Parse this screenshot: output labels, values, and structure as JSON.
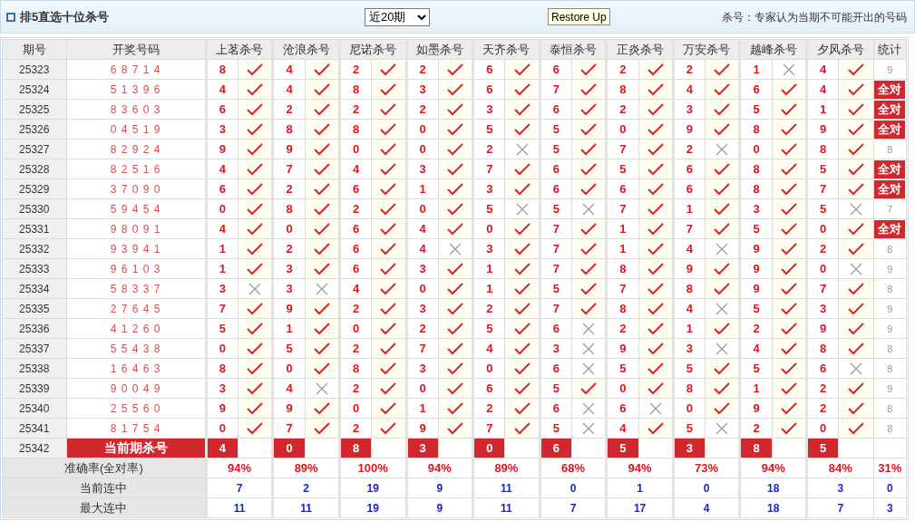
{
  "header": {
    "title": "排5直选十位杀号",
    "period_select": "近20期",
    "restore_button": "Restore Up",
    "note": "杀号：专家认为当期不可能开出的号码"
  },
  "table": {
    "columns": [
      "期号",
      "开奖号码",
      "上茗杀号",
      "沧浪杀号",
      "尼诺杀号",
      "如墨杀号",
      "天齐杀号",
      "泰恒杀号",
      "正炎杀号",
      "万安杀号",
      "越峰杀号",
      "夕风杀号",
      "统计"
    ],
    "rows": [
      {
        "period": "25323",
        "draw": "6 8 7 1 4",
        "picks": [
          "8",
          "4",
          "2",
          "2",
          "6",
          "6",
          "2",
          "2",
          "1",
          "4"
        ],
        "hits": [
          true,
          true,
          true,
          true,
          true,
          true,
          true,
          true,
          false,
          true
        ],
        "stat": {
          "kind": "count",
          "text": "9"
        }
      },
      {
        "period": "25324",
        "draw": "5 1 3 9 6",
        "picks": [
          "4",
          "4",
          "8",
          "3",
          "6",
          "7",
          "8",
          "4",
          "6",
          "4"
        ],
        "hits": [
          true,
          true,
          true,
          true,
          true,
          true,
          true,
          true,
          true,
          true
        ],
        "stat": {
          "kind": "all_correct",
          "text": "全对"
        }
      },
      {
        "period": "25325",
        "draw": "8 3 6 0 3",
        "picks": [
          "6",
          "2",
          "2",
          "2",
          "3",
          "6",
          "2",
          "3",
          "5",
          "1"
        ],
        "hits": [
          true,
          true,
          true,
          true,
          true,
          true,
          true,
          true,
          true,
          true
        ],
        "stat": {
          "kind": "all_correct",
          "text": "全对"
        }
      },
      {
        "period": "25326",
        "draw": "0 4 5 1 9",
        "picks": [
          "3",
          "8",
          "8",
          "0",
          "5",
          "5",
          "0",
          "9",
          "8",
          "9"
        ],
        "hits": [
          true,
          true,
          true,
          true,
          true,
          true,
          true,
          true,
          true,
          true
        ],
        "stat": {
          "kind": "all_correct",
          "text": "全对"
        }
      },
      {
        "period": "25327",
        "draw": "8 2 9 2 4",
        "picks": [
          "9",
          "9",
          "0",
          "0",
          "2",
          "5",
          "7",
          "2",
          "0",
          "8"
        ],
        "hits": [
          true,
          true,
          true,
          true,
          false,
          true,
          true,
          false,
          true,
          true
        ],
        "stat": {
          "kind": "count",
          "text": "8"
        }
      },
      {
        "period": "25328",
        "draw": "8 2 5 1 6",
        "picks": [
          "4",
          "7",
          "4",
          "3",
          "7",
          "6",
          "5",
          "6",
          "8",
          "5"
        ],
        "hits": [
          true,
          true,
          true,
          true,
          true,
          true,
          true,
          true,
          true,
          true
        ],
        "stat": {
          "kind": "all_correct",
          "text": "全对"
        }
      },
      {
        "period": "25329",
        "draw": "3 7 0 9 0",
        "picks": [
          "6",
          "2",
          "6",
          "1",
          "3",
          "6",
          "6",
          "6",
          "8",
          "7"
        ],
        "hits": [
          true,
          true,
          true,
          true,
          true,
          true,
          true,
          true,
          true,
          true
        ],
        "stat": {
          "kind": "all_correct",
          "text": "全对"
        }
      },
      {
        "period": "25330",
        "draw": "5 9 4 5 4",
        "picks": [
          "0",
          "8",
          "2",
          "0",
          "5",
          "5",
          "7",
          "1",
          "3",
          "5"
        ],
        "hits": [
          true,
          true,
          true,
          true,
          false,
          false,
          true,
          true,
          true,
          false
        ],
        "stat": {
          "kind": "count",
          "text": "7"
        }
      },
      {
        "period": "25331",
        "draw": "9 8 0 9 1",
        "picks": [
          "4",
          "0",
          "6",
          "4",
          "0",
          "7",
          "1",
          "7",
          "5",
          "0"
        ],
        "hits": [
          true,
          true,
          true,
          true,
          true,
          true,
          true,
          true,
          true,
          true
        ],
        "stat": {
          "kind": "all_correct",
          "text": "全对"
        }
      },
      {
        "period": "25332",
        "draw": "9 3 9 4 1",
        "picks": [
          "1",
          "2",
          "6",
          "4",
          "3",
          "7",
          "1",
          "4",
          "9",
          "2"
        ],
        "hits": [
          true,
          true,
          true,
          false,
          true,
          true,
          true,
          false,
          true,
          true
        ],
        "stat": {
          "kind": "count",
          "text": "8"
        }
      },
      {
        "period": "25333",
        "draw": "9 6 1 0 3",
        "picks": [
          "1",
          "3",
          "6",
          "3",
          "1",
          "7",
          "8",
          "9",
          "9",
          "0"
        ],
        "hits": [
          true,
          true,
          true,
          true,
          true,
          true,
          true,
          true,
          true,
          false
        ],
        "stat": {
          "kind": "count",
          "text": "9"
        }
      },
      {
        "period": "25334",
        "draw": "5 8 3 3 7",
        "picks": [
          "3",
          "3",
          "4",
          "0",
          "1",
          "5",
          "7",
          "8",
          "9",
          "7"
        ],
        "hits": [
          false,
          false,
          true,
          true,
          true,
          true,
          true,
          true,
          true,
          true
        ],
        "stat": {
          "kind": "count",
          "text": "8"
        }
      },
      {
        "period": "25335",
        "draw": "2 7 6 4 5",
        "picks": [
          "7",
          "9",
          "2",
          "3",
          "2",
          "7",
          "8",
          "4",
          "5",
          "3"
        ],
        "hits": [
          true,
          true,
          true,
          true,
          true,
          true,
          true,
          false,
          true,
          true
        ],
        "stat": {
          "kind": "count",
          "text": "9"
        }
      },
      {
        "period": "25336",
        "draw": "4 1 2 6 0",
        "picks": [
          "5",
          "1",
          "0",
          "2",
          "5",
          "6",
          "2",
          "1",
          "2",
          "9"
        ],
        "hits": [
          true,
          true,
          true,
          true,
          true,
          false,
          true,
          true,
          true,
          true
        ],
        "stat": {
          "kind": "count",
          "text": "9"
        }
      },
      {
        "period": "25337",
        "draw": "5 5 4 3 8",
        "picks": [
          "0",
          "5",
          "2",
          "7",
          "4",
          "3",
          "9",
          "3",
          "4",
          "8"
        ],
        "hits": [
          true,
          true,
          true,
          true,
          true,
          false,
          true,
          false,
          true,
          true
        ],
        "stat": {
          "kind": "count",
          "text": "8"
        }
      },
      {
        "period": "25338",
        "draw": "1 6 4 6 3",
        "picks": [
          "8",
          "0",
          "8",
          "3",
          "0",
          "6",
          "5",
          "5",
          "5",
          "6"
        ],
        "hits": [
          true,
          true,
          true,
          true,
          true,
          false,
          true,
          true,
          true,
          false
        ],
        "stat": {
          "kind": "count",
          "text": "8"
        }
      },
      {
        "period": "25339",
        "draw": "9 0 0 4 9",
        "picks": [
          "3",
          "4",
          "2",
          "0",
          "6",
          "5",
          "0",
          "8",
          "1",
          "2"
        ],
        "hits": [
          true,
          false,
          true,
          true,
          true,
          true,
          true,
          true,
          true,
          true
        ],
        "stat": {
          "kind": "count",
          "text": "9"
        }
      },
      {
        "period": "25340",
        "draw": "2 5 5 6 0",
        "picks": [
          "9",
          "9",
          "0",
          "1",
          "2",
          "6",
          "6",
          "0",
          "9",
          "2"
        ],
        "hits": [
          true,
          true,
          true,
          true,
          true,
          false,
          false,
          true,
          true,
          true
        ],
        "stat": {
          "kind": "count",
          "text": "8"
        }
      },
      {
        "period": "25341",
        "draw": "8 1 7 5 4",
        "picks": [
          "0",
          "7",
          "2",
          "9",
          "7",
          "5",
          "4",
          "5",
          "2",
          "0"
        ],
        "hits": [
          true,
          true,
          true,
          true,
          true,
          false,
          true,
          false,
          true,
          true
        ],
        "stat": {
          "kind": "count",
          "text": "8"
        }
      }
    ],
    "current": {
      "period": "25342",
      "label": "当前期杀号",
      "picks": [
        "4",
        "0",
        "8",
        "3",
        "0",
        "6",
        "5",
        "3",
        "8",
        "5"
      ]
    },
    "summary": [
      {
        "kind": "rate",
        "label": "准确率(全对率)",
        "values": [
          "94%",
          "89%",
          "100%",
          "94%",
          "89%",
          "68%",
          "94%",
          "73%",
          "94%",
          "84%",
          "31%"
        ]
      },
      {
        "kind": "streak",
        "label": "当前连中",
        "values": [
          "7",
          "2",
          "19",
          "9",
          "11",
          "0",
          "1",
          "0",
          "18",
          "3",
          "0"
        ]
      },
      {
        "kind": "streak",
        "label": "最大连中",
        "values": [
          "11",
          "11",
          "19",
          "9",
          "11",
          "7",
          "17",
          "4",
          "18",
          "7",
          "3"
        ]
      }
    ]
  }
}
